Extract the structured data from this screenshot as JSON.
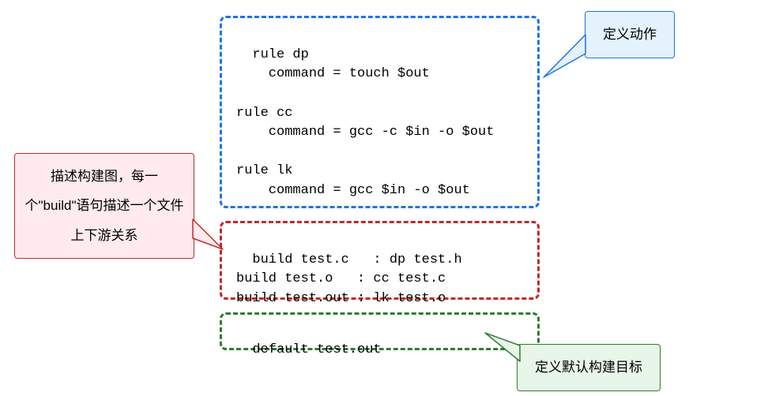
{
  "rules_box": {
    "code": "rule dp\n    command = touch $out\n\nrule cc\n    command = gcc -c $in -o $out\n\nrule lk\n    command = gcc $in -o $out"
  },
  "builds_box": {
    "code": "build test.c   : dp test.h\nbuild test.o   : cc test.c\nbuild test.out : lk test.o"
  },
  "default_box": {
    "code": "default test.out"
  },
  "callouts": {
    "blue": "定义动作",
    "red": "描述构建图，每一个\"build\"语句描述一个文件上下游关系",
    "green": "定义默认构建目标"
  }
}
